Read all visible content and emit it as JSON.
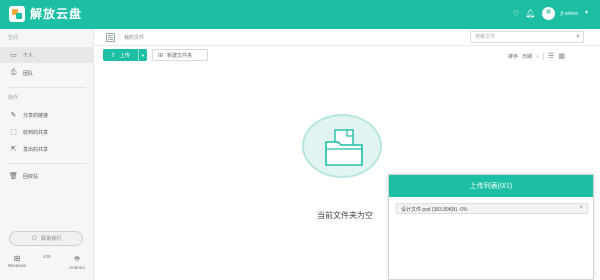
{
  "app": {
    "name": "解放云盘",
    "username": "jf-online"
  },
  "topbar": {
    "icons": [
      "heart-icon",
      "bell-icon",
      "avatar",
      "chevron-down-icon"
    ]
  },
  "sidebar": {
    "space_title": "空间",
    "space_items": [
      {
        "label": "个人",
        "icon": "document-icon",
        "active": true
      },
      {
        "label": "团队",
        "icon": "print-icon",
        "active": false
      }
    ],
    "actions_title": "操作",
    "action_items": [
      {
        "label": "分享的链接",
        "icon": "pencil-icon"
      },
      {
        "label": "收到的共享",
        "icon": "inbox-icon"
      },
      {
        "label": "发出的共享",
        "icon": "outbox-icon"
      }
    ],
    "recycle": {
      "label": "回收站",
      "icon": "trash-icon"
    },
    "feedback_label": "联系我们",
    "platforms": [
      {
        "label": "Windows",
        "icon": "windows-icon"
      },
      {
        "label": "iOS",
        "icon": "apple-icon"
      },
      {
        "label": "Android",
        "icon": "android-icon"
      }
    ]
  },
  "breadcrumb": {
    "label": "我的文件"
  },
  "search": {
    "placeholder": "搜索文件",
    "value": ""
  },
  "toolbar": {
    "upload_label": "上传",
    "new_folder_label": "新建文件夹",
    "sort_label": "排序",
    "sort_field": "日期"
  },
  "main": {
    "empty_text": "当前文件夹为空"
  },
  "upload_panel": {
    "title": "上传列表(0/1)",
    "items": [
      {
        "name": "设计文件.psd (383.89KB) -0%",
        "progress": 0
      }
    ]
  },
  "colors": {
    "accent": "#1dbfa4",
    "sidebar_bg": "#f6f6f6"
  }
}
